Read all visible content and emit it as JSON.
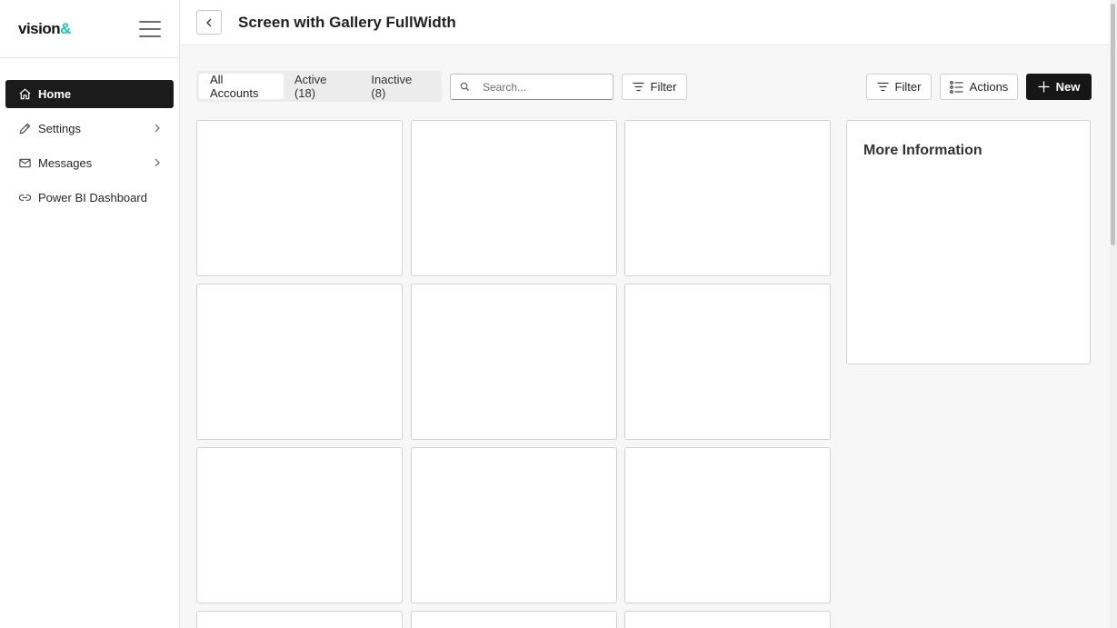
{
  "brand": {
    "logo_text": "vision",
    "logo_amp": "&"
  },
  "sidebar": {
    "items": [
      {
        "label": "Home",
        "icon": "home-icon",
        "active": true
      },
      {
        "label": "Settings",
        "icon": "pencil-icon",
        "has_submenu": true
      },
      {
        "label": "Messages",
        "icon": "mail-icon",
        "has_submenu": true
      },
      {
        "label": "Power BI Dashboard",
        "icon": "link-icon"
      }
    ]
  },
  "header": {
    "title": "Screen with Gallery FullWidth"
  },
  "tabs": [
    {
      "label": "All Accounts",
      "selected": true
    },
    {
      "label": "Active (18)"
    },
    {
      "label": "Inactive (8)"
    }
  ],
  "search": {
    "placeholder": "Search..."
  },
  "toolbar": {
    "filter_label": "Filter",
    "filter2_label": "Filter",
    "actions_label": "Actions",
    "new_label": "New"
  },
  "info_panel": {
    "title": "More Information"
  },
  "colors": {
    "accent": "#19c2b0",
    "primary": "#161616"
  }
}
